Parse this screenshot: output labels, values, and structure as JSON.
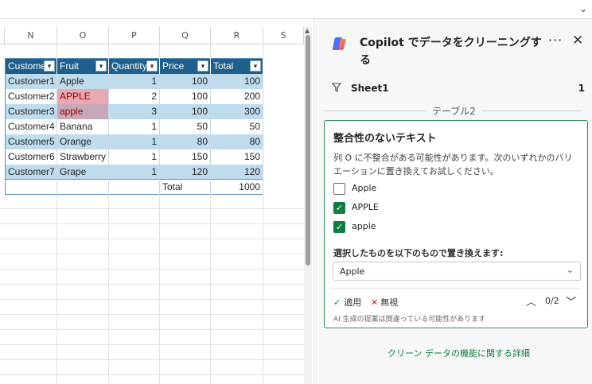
{
  "columns": [
    "N",
    "O",
    "P",
    "Q",
    "R",
    "S"
  ],
  "table": {
    "headers": [
      "Custome",
      "Fruit",
      "Quantity",
      "Price",
      "Total"
    ],
    "rows": [
      [
        "Customer1",
        "Apple",
        "1",
        "100",
        "100"
      ],
      [
        "Customer2",
        "APPLE",
        "2",
        "100",
        "200"
      ],
      [
        "Customer3",
        "apple",
        "3",
        "100",
        "300"
      ],
      [
        "Customer4",
        "Banana",
        "1",
        "50",
        "50"
      ],
      [
        "Customer5",
        "Orange",
        "1",
        "80",
        "80"
      ],
      [
        "Customer6",
        "Strawberry",
        "1",
        "150",
        "150"
      ],
      [
        "Customer7",
        "Grape",
        "1",
        "120",
        "120"
      ]
    ],
    "total_label": "Total",
    "total_value": "1000"
  },
  "pane": {
    "title": "Copilot でデータをクリーニングする",
    "more_glyph": "···",
    "close_glyph": "✕",
    "sheet_name": "Sheet1",
    "sheet_count": "1",
    "table_name": "テーブル2",
    "card": {
      "title": "整合性のないテキスト",
      "description": "列 O に不整合がある可能性があります。次のいずれかのバリエーションに置き換えてお試しください。",
      "options": [
        {
          "label": "Apple",
          "checked": false
        },
        {
          "label": "APPLE",
          "checked": true
        },
        {
          "label": "apple",
          "checked": true
        }
      ],
      "replace_label": "選択したものを以下のもので置き換えます:",
      "replace_value": "Apple",
      "apply_label": "適用",
      "ignore_label": "無視",
      "counter": "0/2",
      "disclaimer": "AI 生成の提案は間違っている可能性があります"
    },
    "learn_more": "クリーン データの機能に関する詳細"
  },
  "colors": {
    "table_header": "#1e5f8c",
    "band": "#bfdcef",
    "highlight": "#e8a8b4",
    "accent": "#107c41"
  }
}
